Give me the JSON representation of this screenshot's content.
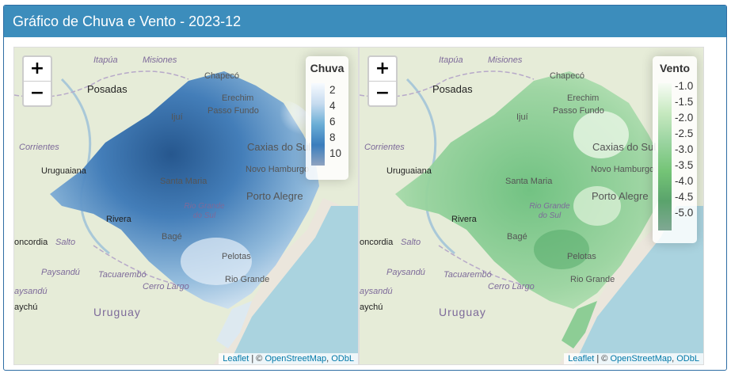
{
  "panel": {
    "title": "Gráfico de Chuva e Vento - 2023-12"
  },
  "zoom": {
    "in": "+",
    "out": "−"
  },
  "attribution": {
    "leaflet": "Leaflet",
    "sep": " | © ",
    "osm": "OpenStreetMap",
    "comma": ", ",
    "odbl": "ODbL"
  },
  "places": {
    "itapua": "Itapúa",
    "misiones": "Misiones",
    "posadas": "Posadas",
    "chapeco": "Chapecó",
    "erechim": "Erechim",
    "passo_fundo": "Passo Fundo",
    "ijui": "Ijuí",
    "corrientes": "Corrientes",
    "caxias": "Caxias do Sul",
    "novo_hamburgo": "Novo Hamburgo",
    "uruguaiana": "Uruguaiana",
    "santa_maria": "Santa Maria",
    "porto_alegre": "Porto Alegre",
    "rio_grande_do_sul": "Rio Grande do Sul",
    "rivera": "Rivera",
    "salto": "Salto",
    "bage": "Bagé",
    "pelotas": "Pelotas",
    "paysandu": "Paysandú",
    "tacuarembo": "Tacuarembó",
    "rio_grande": "Rio Grande",
    "cerro_largo": "Cerro Largo",
    "concordia": "oncordia",
    "uruguay": "Uruguay",
    "gualeguaychu": "aychú",
    "paysandu_left": "aysandú"
  },
  "legend_chuva": {
    "title": "Chuva",
    "ticks": [
      "2",
      "4",
      "6",
      "8",
      "10"
    ],
    "color_low": "#f7fbff",
    "color_high": "#08519c"
  },
  "legend_vento": {
    "title": "Vento",
    "ticks": [
      "-1.0",
      "-1.5",
      "-2.0",
      "-2.5",
      "-3.0",
      "-3.5",
      "-4.0",
      "-4.5",
      "-5.0"
    ],
    "color_low": "#f7fcf5",
    "color_high": "#238b45"
  }
}
